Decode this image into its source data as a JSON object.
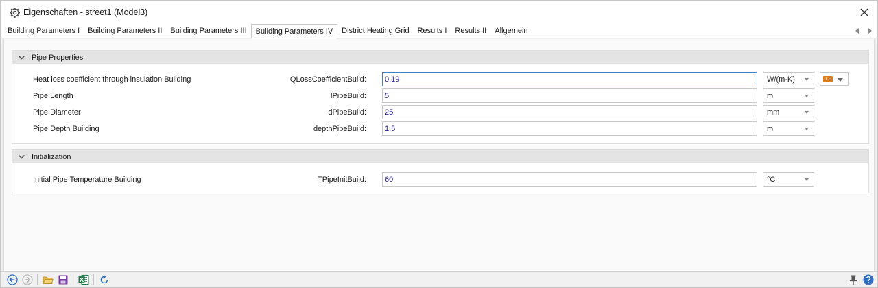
{
  "window": {
    "title": "Eigenschaften - street1 (Model3)"
  },
  "tabs": [
    {
      "label": "Building Parameters I",
      "active": false
    },
    {
      "label": "Building Parameters II",
      "active": false
    },
    {
      "label": "Building Parameters III",
      "active": false
    },
    {
      "label": "Building Parameters IV",
      "active": true
    },
    {
      "label": "District Heating Grid",
      "active": false
    },
    {
      "label": "Results I",
      "active": false
    },
    {
      "label": "Results II",
      "active": false
    },
    {
      "label": "Allgemein",
      "active": false
    }
  ],
  "sections": {
    "pipe": {
      "title": "Pipe Properties",
      "rows": [
        {
          "label": "Heat loss coefficient through insulation Building",
          "param": "QLossCoefficientBuild:",
          "value": "0.19",
          "unit": "W/(m·K)",
          "value_indicator": "1.0"
        },
        {
          "label": "Pipe Length",
          "param": "lPipeBuild:",
          "value": "5",
          "unit": "m"
        },
        {
          "label": "Pipe Diameter",
          "param": "dPipeBuild:",
          "value": "25",
          "unit": "mm"
        },
        {
          "label": "Pipe Depth Building",
          "param": "depthPipeBuild:",
          "value": "1.5",
          "unit": "m"
        }
      ]
    },
    "init": {
      "title": "Initialization",
      "rows": [
        {
          "label": "Initial Pipe Temperature Building",
          "param": "TPipeInitBuild:",
          "value": "60",
          "unit": "°C"
        }
      ]
    }
  },
  "toolbar_icons": [
    "back-icon",
    "forward-icon",
    "open-folder-icon",
    "save-icon",
    "excel-icon",
    "refresh-icon",
    "pin-icon",
    "help-icon"
  ],
  "colors": {
    "accent_focus": "#4a7cc9",
    "value_text": "#1a1a8c",
    "badge": "#e07a1f",
    "section_header": "#e4e4e4"
  }
}
